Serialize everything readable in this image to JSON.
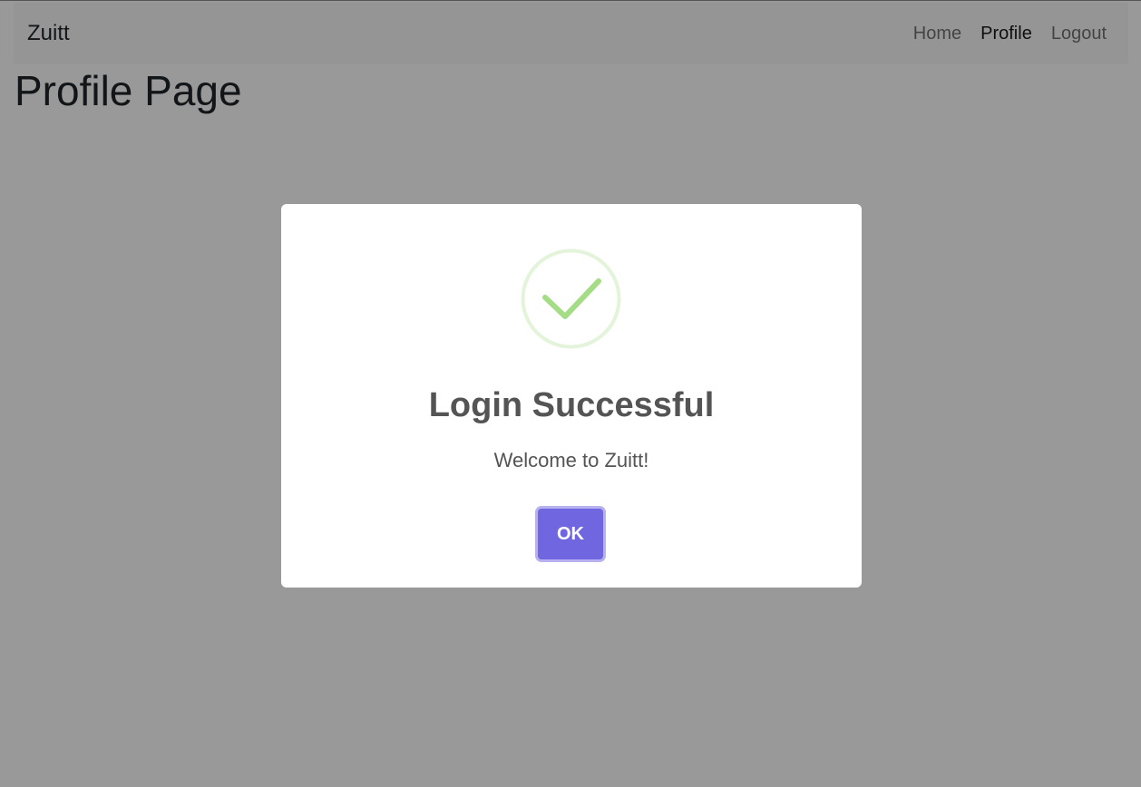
{
  "navbar": {
    "brand": "Zuitt",
    "links": [
      {
        "label": "Home",
        "active": false
      },
      {
        "label": "Profile",
        "active": true
      },
      {
        "label": "Logout",
        "active": false
      }
    ]
  },
  "main": {
    "title": "Profile Page"
  },
  "modal": {
    "icon": "success-check-icon",
    "title": "Login Successful",
    "text": "Welcome to Zuitt!",
    "confirm_label": "OK"
  },
  "colors": {
    "confirm_button": "#7066e0",
    "success_icon": "#a5dc86",
    "overlay": "rgba(0,0,0,0.4)"
  }
}
